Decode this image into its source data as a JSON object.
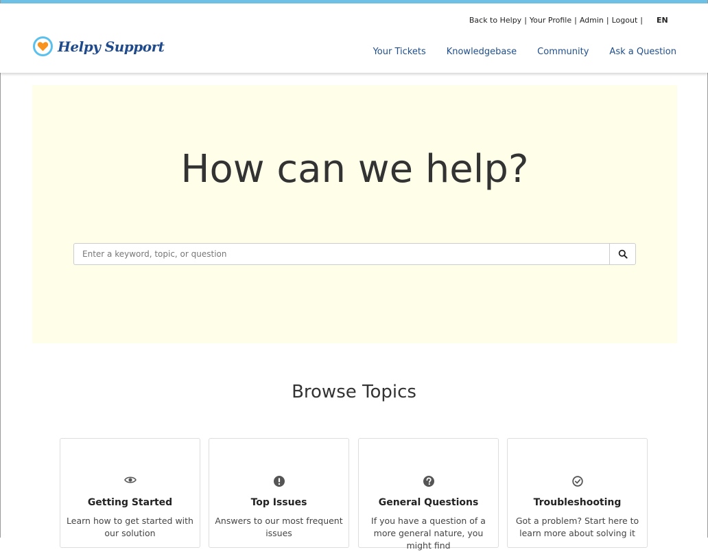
{
  "header": {
    "brand": "Helpy Support",
    "util_links": [
      "Back to Helpy",
      "Your Profile",
      "Admin",
      "Logout"
    ],
    "language": "EN",
    "nav": [
      "Your Tickets",
      "Knowledgebase",
      "Community",
      "Ask a Question"
    ]
  },
  "hero": {
    "title": "How can we help?",
    "search_placeholder": "Enter a keyword, topic, or question"
  },
  "browse": {
    "title": "Browse Topics",
    "cards": [
      {
        "icon": "eye-icon",
        "title": "Getting Started",
        "desc": "Learn how to get started with our solution"
      },
      {
        "icon": "exclamation-icon",
        "title": "Top Issues",
        "desc": "Answers to our most frequent issues"
      },
      {
        "icon": "question-icon",
        "title": "General Questions",
        "desc": "If you have a question of a more general nature, you might find"
      },
      {
        "icon": "check-circle-icon",
        "title": "Troubleshooting",
        "desc": "Got a problem? Start here to learn more about solving it"
      }
    ]
  },
  "colors": {
    "accent": "#6ec1e4",
    "nav_link": "#1e4e8c",
    "hero_bg": "#fefee9",
    "heart": "#f7931e"
  }
}
